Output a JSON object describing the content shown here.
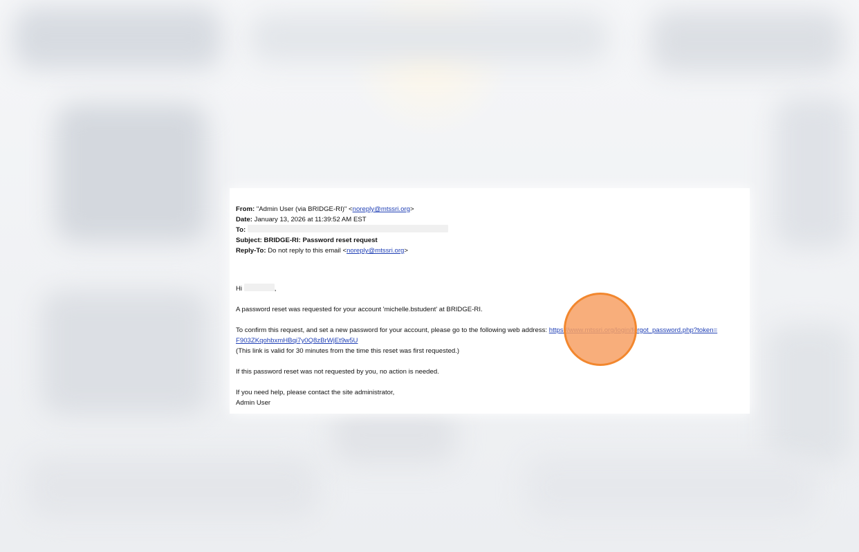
{
  "email": {
    "from_label": "From:",
    "from_name": "\"Admin User  (via BRIDGE-RI)\"",
    "from_address": "noreply@mtssri.org",
    "date_label": "Date:",
    "date_value": "January 13, 2026 at 11:39:52 AM EST",
    "to_label": "To:",
    "subject_label": "Subject:",
    "subject_value": "BRIDGE-RI: Password reset request",
    "replyto_label": "Reply-To:",
    "replyto_text": "Do not reply to this email",
    "replyto_address": "noreply@mtssri.org",
    "greeting": "Hi",
    "line1": "A password reset was requested for your account 'michelle.bstudent' at BRIDGE-RI.",
    "line2": "To confirm this request, and set a new password for your account, please go to the following web address:",
    "reset_link_part1": "https://www.mtssri.org/login/forgot_password.php?token=",
    "reset_link_part2": "F903ZKqohbxmHBqi7y0Q8zBrWjEt9w5U",
    "line3": "(This link is valid for 30 minutes from the time this reset was first requested.)",
    "line4": "If this password reset was not requested by you, no action is needed.",
    "line5": "If you need help, please contact the site administrator,",
    "signature": "Admin User"
  },
  "colors": {
    "link": "#1f3fb5",
    "cursor_fill": "#f7a064",
    "cursor_border": "#f2872e"
  }
}
